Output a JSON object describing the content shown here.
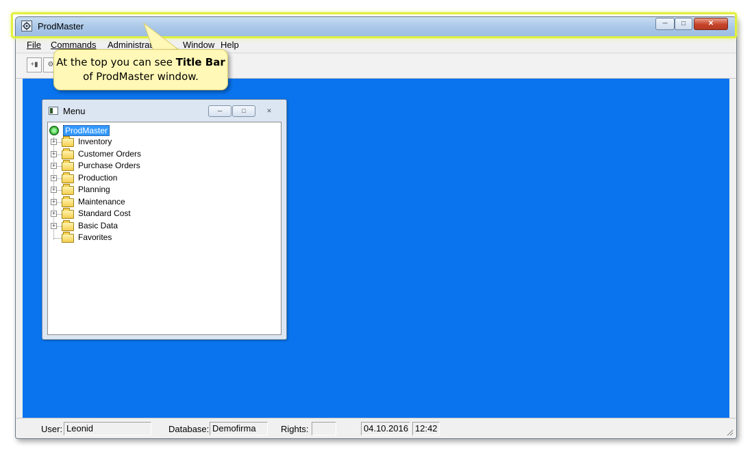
{
  "window": {
    "title": "ProdMaster"
  },
  "menu": {
    "file": "File",
    "commands": "Commands",
    "administration": "Administration",
    "window": "Window",
    "help": "Help"
  },
  "child": {
    "title": "Menu",
    "root": "ProdMaster",
    "items": [
      {
        "label": "Inventory",
        "expandable": true
      },
      {
        "label": "Customer Orders",
        "expandable": true
      },
      {
        "label": "Purchase Orders",
        "expandable": true
      },
      {
        "label": "Production",
        "expandable": true
      },
      {
        "label": "Planning",
        "expandable": true
      },
      {
        "label": "Maintenance",
        "expandable": true
      },
      {
        "label": "Standard Cost",
        "expandable": true
      },
      {
        "label": "Basic Data",
        "expandable": true
      },
      {
        "label": "Favorites",
        "expandable": false
      }
    ]
  },
  "status": {
    "user_label": "User:",
    "user_value": "Leonid",
    "database_label": "Database:",
    "database_value": "Demofirma",
    "rights_label": "Rights:",
    "rights_value": "",
    "date": "04.10.2016",
    "time": "12:42"
  },
  "callout": {
    "text_before": "At the top you can see ",
    "text_bold": "Title Bar",
    "text_after": "of ProdMaster window."
  },
  "colors": {
    "mdi_background": "#0a74ee",
    "highlight": "#e0f03c",
    "callout_background": "#fff8b6"
  }
}
